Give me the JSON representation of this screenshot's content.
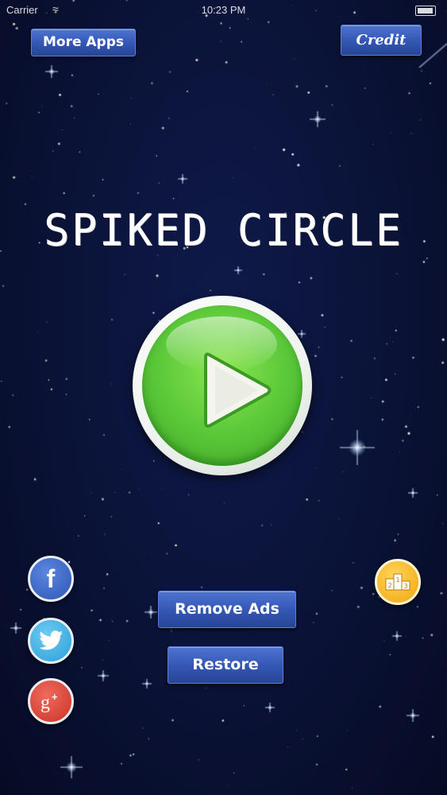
{
  "status_bar": {
    "carrier": "Carrier",
    "time": "10:23 PM"
  },
  "header": {
    "more_apps_label": "More Apps",
    "credit_label": "Credit"
  },
  "title": "SPIKED CIRCLE",
  "play": {
    "icon": "play-icon"
  },
  "store": {
    "remove_ads_label": "Remove Ads",
    "restore_label": "Restore"
  },
  "social": {
    "facebook_icon": "facebook-icon",
    "twitter_icon": "twitter-icon",
    "google_plus_icon": "google-plus-icon"
  },
  "leaderboard": {
    "icon": "podium-icon"
  },
  "colors": {
    "background": "#0a1236",
    "button_blue": "#3558b6",
    "play_green": "#5cc93a"
  }
}
